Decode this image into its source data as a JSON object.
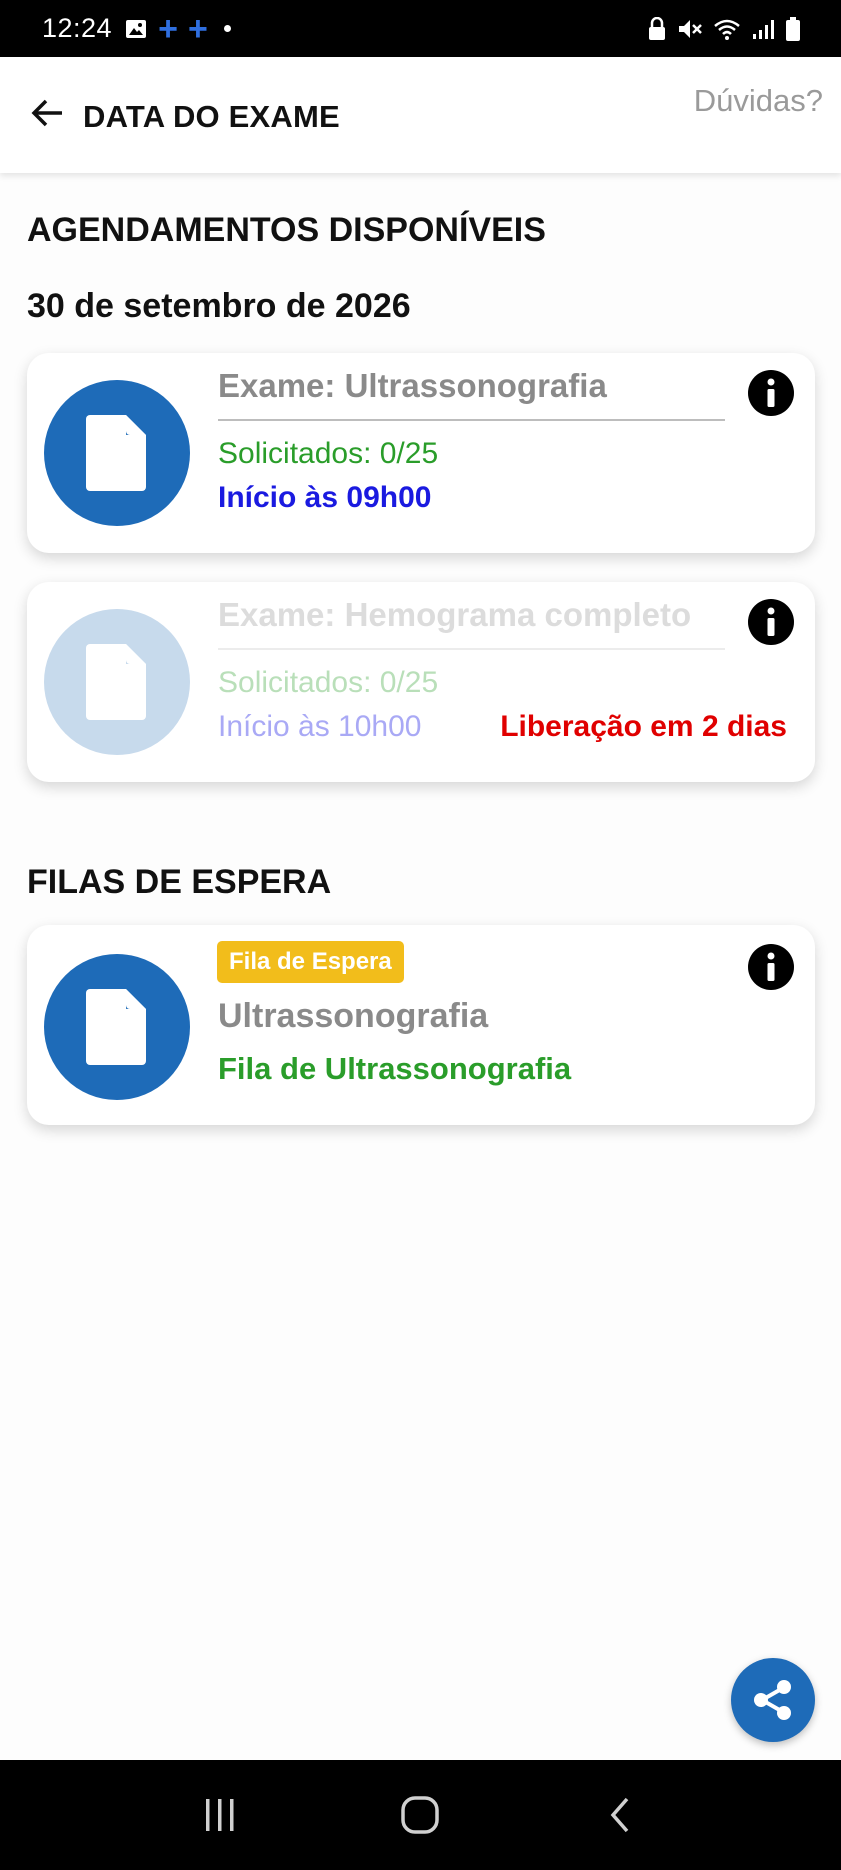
{
  "status_bar": {
    "time": "12:24",
    "icons_left": [
      "image-icon",
      "plus-icon",
      "plus-icon",
      "dot-icon"
    ],
    "icons_right": [
      "lock-icon",
      "mute-icon",
      "wifi-icon",
      "signal-icon",
      "battery-icon"
    ]
  },
  "header": {
    "title": "DATA DO EXAME",
    "help_label": "Dúvidas?"
  },
  "available": {
    "section_title": "AGENDAMENTOS DISPONÍVEIS",
    "date": "30 de setembro de 2026",
    "cards": [
      {
        "exam": "Exame: Ultrassonografia",
        "requested": "Solicitados: 0/25",
        "start": "Início às 09h00",
        "release": "",
        "enabled": true
      },
      {
        "exam": "Exame: Hemograma completo",
        "requested": "Solicitados: 0/25",
        "start": "Início às 10h00",
        "release": "Liberação em 2 dias",
        "enabled": false
      }
    ]
  },
  "queues": {
    "section_title": "FILAS DE ESPERA",
    "cards": [
      {
        "badge": "Fila de Espera",
        "name": "Ultrassonografia",
        "queue": "Fila de Ultrassonografia"
      }
    ]
  },
  "colors": {
    "brand_blue": "#1e6bb8",
    "requested_green": "#2a9d2a",
    "start_blue": "#1a1ae0",
    "release_red": "#e00000",
    "badge_yellow": "#f2bd1b"
  }
}
